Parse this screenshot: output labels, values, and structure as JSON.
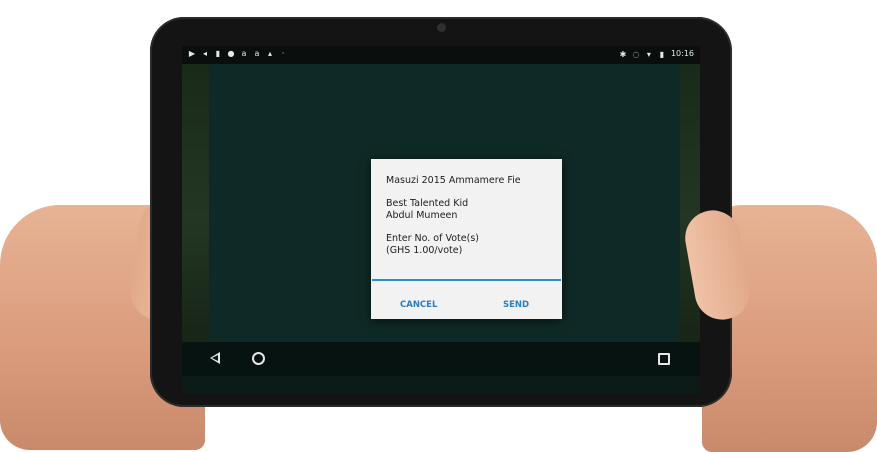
{
  "status_bar": {
    "left_icons": [
      "play-icon",
      "cast-icon",
      "clipboard-icon",
      "location-icon",
      "font-a-icon",
      "font-a-icon",
      "photo-icon",
      "dot-icon"
    ],
    "right_icons": [
      "bluetooth-icon",
      "sync-icon",
      "wifi-icon",
      "battery-icon"
    ],
    "time": "10:16"
  },
  "dialog": {
    "title": "Masuzi 2015 Ammamere Fie",
    "category": "Best Talented Kid",
    "nominee": "Abdul Mumeen",
    "prompt": "Enter No. of Vote(s)",
    "rate": "(GHS 1.00/vote)",
    "input_value": "",
    "cancel_label": "CANCEL",
    "send_label": "SEND"
  },
  "colors": {
    "accent": "#2a7fc4",
    "input_underline": "#2d8ccf",
    "app_background": "#0f2a26",
    "dialog_background": "#f2f2f2"
  },
  "nav_bar": {
    "icons": [
      "back-icon",
      "home-icon",
      "recents-icon"
    ]
  }
}
